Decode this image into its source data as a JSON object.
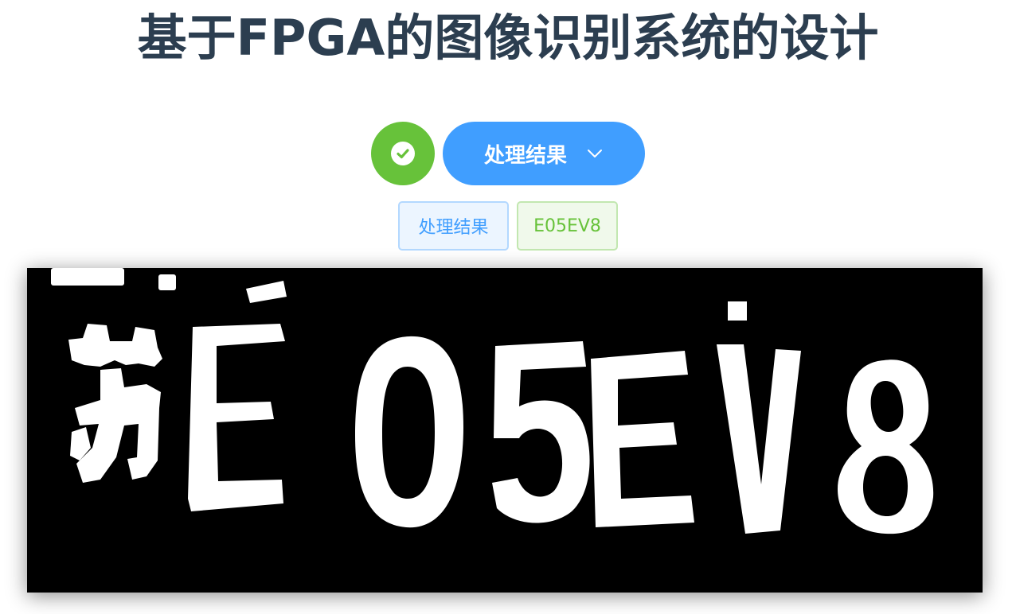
{
  "header": {
    "title": "基于FPGA的图像识别系统的设计"
  },
  "controls": {
    "status_icon": "check-circle-icon",
    "status_color": "#67c23a",
    "dropdown_label": "处理结果",
    "dropdown_icon": "chevron-down-icon",
    "accent_color": "#409eff"
  },
  "tags": {
    "label_tag": "处理结果",
    "result_tag": "E05EV8"
  },
  "result_image": {
    "description_icon": "binarized-plate-image",
    "plate_glyphs": [
      "苏",
      "E",
      "0",
      "5",
      "E",
      "V",
      "8"
    ]
  }
}
